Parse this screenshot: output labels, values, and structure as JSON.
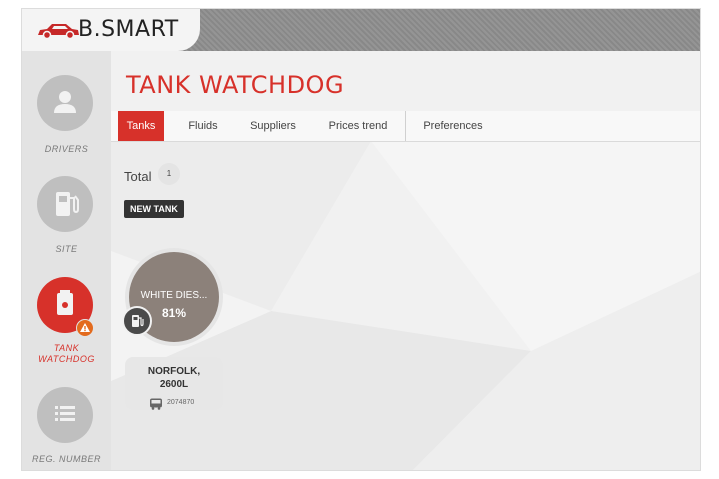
{
  "brand": {
    "logo_text": "B.SMART",
    "accent": "#d7312a"
  },
  "sidebar": {
    "items": [
      {
        "label": "DRIVERS",
        "icon": "person-icon"
      },
      {
        "label": "SITE",
        "icon": "fuel-pump-icon"
      },
      {
        "label": "TANK\nWATCHDOG",
        "icon": "tank-icon",
        "active": true,
        "alert": "warning-icon"
      },
      {
        "label": "REG. NUMBER",
        "icon": "list-icon"
      }
    ]
  },
  "page": {
    "title": "TANK WATCHDOG"
  },
  "tabs": [
    {
      "label": "Tanks",
      "active": true
    },
    {
      "label": "Fluids"
    },
    {
      "label": "Suppliers"
    },
    {
      "label": "Prices trend"
    },
    {
      "label": "Preferences"
    }
  ],
  "content": {
    "total_label": "Total",
    "total_count": "1",
    "new_tank_label": "NEW TANK",
    "tank": {
      "fluid": "WHITE DIES...",
      "percent": "81%",
      "level_fraction": 0.81,
      "name": "NORFOLK,",
      "capacity": "2600L",
      "reg": "2074870",
      "icon": "bus-icon"
    }
  }
}
